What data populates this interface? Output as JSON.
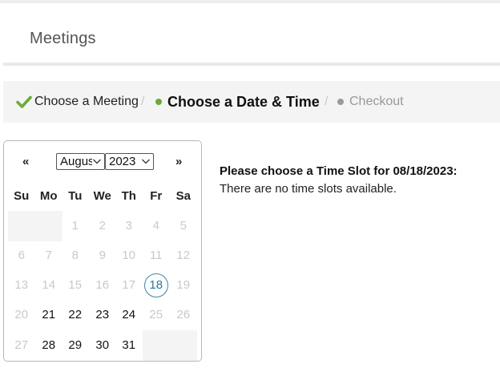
{
  "header": {
    "title": "Meetings"
  },
  "breadcrumb": {
    "step1": "Choose a Meeting",
    "step2": "Choose a Date & Time",
    "step3": "Checkout",
    "separator": "/"
  },
  "calendar": {
    "prev": "«",
    "next": "»",
    "month": "August",
    "year": "2023",
    "weekdays": [
      "Su",
      "Mo",
      "Tu",
      "We",
      "Th",
      "Fr",
      "Sa"
    ],
    "selected_day": 18,
    "weeks": [
      [
        null,
        null,
        "1",
        "2",
        "3",
        "4",
        "5"
      ],
      [
        "6",
        "7",
        "8",
        "9",
        "10",
        "11",
        "12"
      ],
      [
        "13",
        "14",
        "15",
        "16",
        "17",
        "18",
        "19"
      ],
      [
        "20",
        "21",
        "22",
        "23",
        "24",
        "25",
        "26"
      ],
      [
        "27",
        "28",
        "29",
        "30",
        "31",
        null,
        null
      ]
    ],
    "available_days": [
      "18",
      "21",
      "22",
      "23",
      "24",
      "28",
      "29",
      "30",
      "31"
    ]
  },
  "slots": {
    "heading": "Please choose a Time Slot for 08/18/2023:",
    "message": "There are no time slots available."
  },
  "colors": {
    "accent_green": "#6aac3a",
    "today_ring": "#3a86a8",
    "muted_text": "#c9c9c9"
  }
}
